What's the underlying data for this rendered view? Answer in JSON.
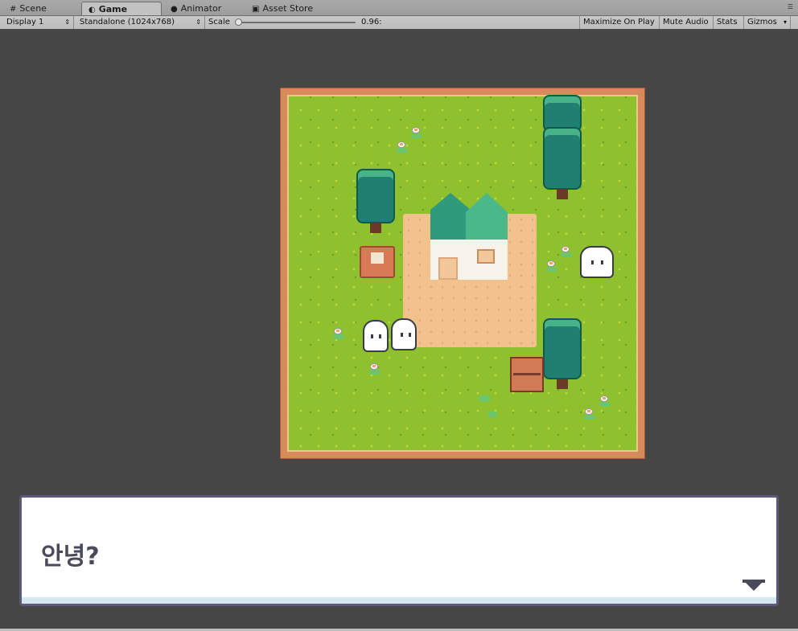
{
  "tabs": [
    {
      "label": "Scene",
      "icon": "grid-icon"
    },
    {
      "label": "Game",
      "icon": "pacman-icon",
      "active": true
    },
    {
      "label": "Animator",
      "icon": "animator-icon"
    },
    {
      "label": "Asset Store",
      "icon": "store-icon"
    }
  ],
  "toolbar": {
    "display": "Display 1",
    "resolution": "Standalone (1024x768)",
    "scale_label": "Scale",
    "scale_value": "0.96:",
    "maximize_on_play": "Maximize On Play",
    "mute_audio": "Mute Audio",
    "stats": "Stats",
    "gizmos": "Gizmos"
  },
  "dialog": {
    "text": "안녕?"
  },
  "colors": {
    "grass": "#8fc02e",
    "dirt": "#f1c28c",
    "border": "#d88a5a",
    "dialog_border": "#5d5a77"
  }
}
